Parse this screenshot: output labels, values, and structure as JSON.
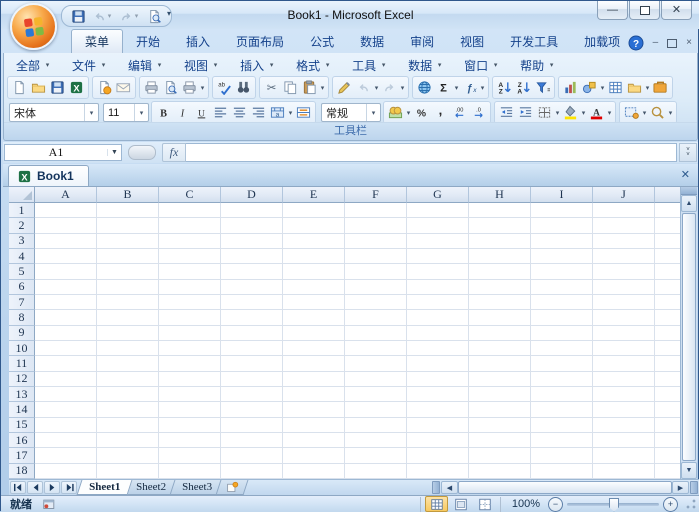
{
  "window": {
    "title": "Book1 - Microsoft Excel",
    "controls": [
      "minimize",
      "restore",
      "close"
    ]
  },
  "quick_access": {
    "icons": [
      "save-icon",
      "undo-icon",
      "redo-icon",
      "print-preview-icon",
      "customize-quick-access-icon"
    ]
  },
  "ribbon": {
    "tabs": [
      {
        "label": "菜单",
        "active": true
      },
      {
        "label": "开始"
      },
      {
        "label": "插入"
      },
      {
        "label": "页面布局"
      },
      {
        "label": "公式"
      },
      {
        "label": "数据"
      },
      {
        "label": "审阅"
      },
      {
        "label": "视图"
      },
      {
        "label": "开发工具"
      },
      {
        "label": "加载项"
      }
    ],
    "group_label": "工具栏",
    "help_icon": "help-icon"
  },
  "menu_bar": {
    "items": [
      "全部",
      "文件",
      "编辑",
      "视图",
      "插入",
      "格式",
      "工具",
      "数据",
      "窗口",
      "帮助"
    ]
  },
  "toolbar_row1": {
    "groups": [
      {
        "buttons": [
          {
            "name": "new-button",
            "icon": "new-doc-icon"
          },
          {
            "name": "open-button",
            "icon": "open-folder-icon"
          },
          {
            "name": "save-button",
            "icon": "save-disk-icon"
          },
          {
            "name": "workbook-button",
            "icon": "excel-workbook-icon"
          }
        ]
      },
      {
        "buttons": [
          {
            "name": "permission-button",
            "icon": "permission-icon"
          },
          {
            "name": "email-button",
            "icon": "envelope-icon"
          }
        ]
      },
      {
        "buttons": [
          {
            "name": "print-button",
            "icon": "printer-icon"
          },
          {
            "name": "print-preview-button",
            "icon": "print-preview-icon"
          },
          {
            "name": "print-area-button",
            "icon": "printer-icon",
            "dropdown": true
          }
        ]
      },
      {
        "buttons": [
          {
            "name": "spelling-button",
            "icon": "spellcheck-icon"
          },
          {
            "name": "research-button",
            "icon": "binoculars-icon"
          }
        ]
      },
      {
        "buttons": [
          {
            "name": "cut-button",
            "icon": "scissors-icon"
          },
          {
            "name": "copy-button",
            "icon": "copy-icon"
          },
          {
            "name": "paste-button",
            "icon": "clipboard-paste-icon",
            "dropdown": true
          }
        ]
      },
      {
        "buttons": [
          {
            "name": "format-painter-button",
            "icon": "paintbrush-icon"
          },
          {
            "name": "undo-button",
            "icon": "undo-icon",
            "dropdown": true,
            "disabled": true
          },
          {
            "name": "redo-button",
            "icon": "redo-icon",
            "dropdown": true,
            "disabled": true
          }
        ]
      },
      {
        "buttons": [
          {
            "name": "hyperlink-button",
            "icon": "globe-link-icon"
          },
          {
            "name": "autosum-button",
            "icon": "sigma-icon",
            "dropdown": true
          },
          {
            "name": "insert-function-button",
            "icon": "fx-icon",
            "dropdown": true
          }
        ]
      },
      {
        "buttons": [
          {
            "name": "sort-ascending-button",
            "icon": "sort-az-icon"
          },
          {
            "name": "sort-descending-button",
            "icon": "sort-za-icon"
          },
          {
            "name": "autofilter-button",
            "icon": "filter-funnel-icon"
          }
        ]
      },
      {
        "buttons": [
          {
            "name": "chart-wizard-button",
            "icon": "bar-chart-icon"
          },
          {
            "name": "drawing-button",
            "icon": "shapes-icon",
            "dropdown": true
          },
          {
            "name": "table-button",
            "icon": "table-grid-icon"
          },
          {
            "name": "folder-button",
            "icon": "folder-icon",
            "dropdown": true
          },
          {
            "name": "toolbox-button",
            "icon": "toolbox-icon"
          }
        ]
      }
    ]
  },
  "toolbar_row2": {
    "items": [
      {
        "type": "select",
        "name": "font-name-select",
        "value": "宋体",
        "width": 84
      },
      {
        "type": "select",
        "name": "font-size-select",
        "value": "11",
        "width": 40
      },
      {
        "type": "group",
        "buttons": [
          {
            "name": "bold-button",
            "icon": "bold-icon"
          },
          {
            "name": "italic-button",
            "icon": "italic-icon"
          },
          {
            "name": "underline-button",
            "icon": "underline-icon"
          },
          {
            "name": "align-left-button",
            "icon": "align-left-icon"
          },
          {
            "name": "align-center-button",
            "icon": "align-center-icon"
          },
          {
            "name": "align-right-button",
            "icon": "align-right-icon"
          },
          {
            "name": "merge-center-button",
            "icon": "merge-center-icon",
            "dropdown": true
          },
          {
            "name": "merge-across-button",
            "icon": "merge-across-icon"
          }
        ]
      },
      {
        "type": "select",
        "name": "number-format-select",
        "value": "常规",
        "width": 54
      },
      {
        "type": "group",
        "buttons": [
          {
            "name": "currency-style-button",
            "icon": "coins-icon",
            "dropdown": true
          },
          {
            "name": "percent-style-button",
            "icon": "percent-icon"
          },
          {
            "name": "comma-style-button",
            "icon": "comma-icon"
          },
          {
            "name": "increase-decimal-button",
            "icon": "increase-decimal-icon"
          },
          {
            "name": "decrease-decimal-button",
            "icon": "decrease-decimal-icon"
          }
        ]
      },
      {
        "type": "group",
        "buttons": [
          {
            "name": "decrease-indent-button",
            "icon": "decrease-indent-icon"
          },
          {
            "name": "increase-indent-button",
            "icon": "increase-indent-icon"
          },
          {
            "name": "borders-button",
            "icon": "borders-icon",
            "dropdown": true
          },
          {
            "name": "fill-color-button",
            "icon": "fill-color-icon",
            "dropdown": true
          },
          {
            "name": "font-color-button",
            "icon": "font-color-icon",
            "dropdown": true
          }
        ]
      },
      {
        "type": "group",
        "buttons": [
          {
            "name": "camera-button",
            "icon": "frame-icon",
            "dropdown": true
          },
          {
            "name": "zoom-tool-button",
            "icon": "magnifier-icon",
            "dropdown": true
          }
        ]
      }
    ]
  },
  "formula_bar": {
    "name_box_value": "A1",
    "fx_label": "fx",
    "formula_value": ""
  },
  "doc_tabs": {
    "tabs": [
      {
        "label": "Book1",
        "active": true
      }
    ]
  },
  "grid": {
    "columns": [
      "A",
      "B",
      "C",
      "D",
      "E",
      "F",
      "G",
      "H",
      "I",
      "J"
    ],
    "rows": [
      "1",
      "2",
      "3",
      "4",
      "5",
      "6",
      "7",
      "8",
      "9",
      "10",
      "11",
      "12",
      "13",
      "14",
      "15",
      "16",
      "17",
      "18"
    ]
  },
  "sheet_tabs": {
    "tabs": [
      {
        "label": "Sheet1",
        "active": true
      },
      {
        "label": "Sheet2",
        "active": false
      },
      {
        "label": "Sheet3",
        "active": false
      }
    ],
    "nav_icons": [
      "first-sheet-icon",
      "previous-sheet-icon",
      "next-sheet-icon",
      "last-sheet-icon"
    ],
    "insert_icon": "insert-worksheet-icon"
  },
  "status_bar": {
    "ready_label": "就绪",
    "macro_icon": "macro-record-icon",
    "view_icons": [
      "normal-view-icon",
      "page-layout-view-icon",
      "page-break-view-icon"
    ],
    "zoom_level": "100%"
  },
  "colors": {
    "menu_text": "#15428b",
    "active_view_highlight": "#f8c95f",
    "title_gradient_top": "#eaf4fd",
    "grid_line": "#d9e1ec"
  }
}
